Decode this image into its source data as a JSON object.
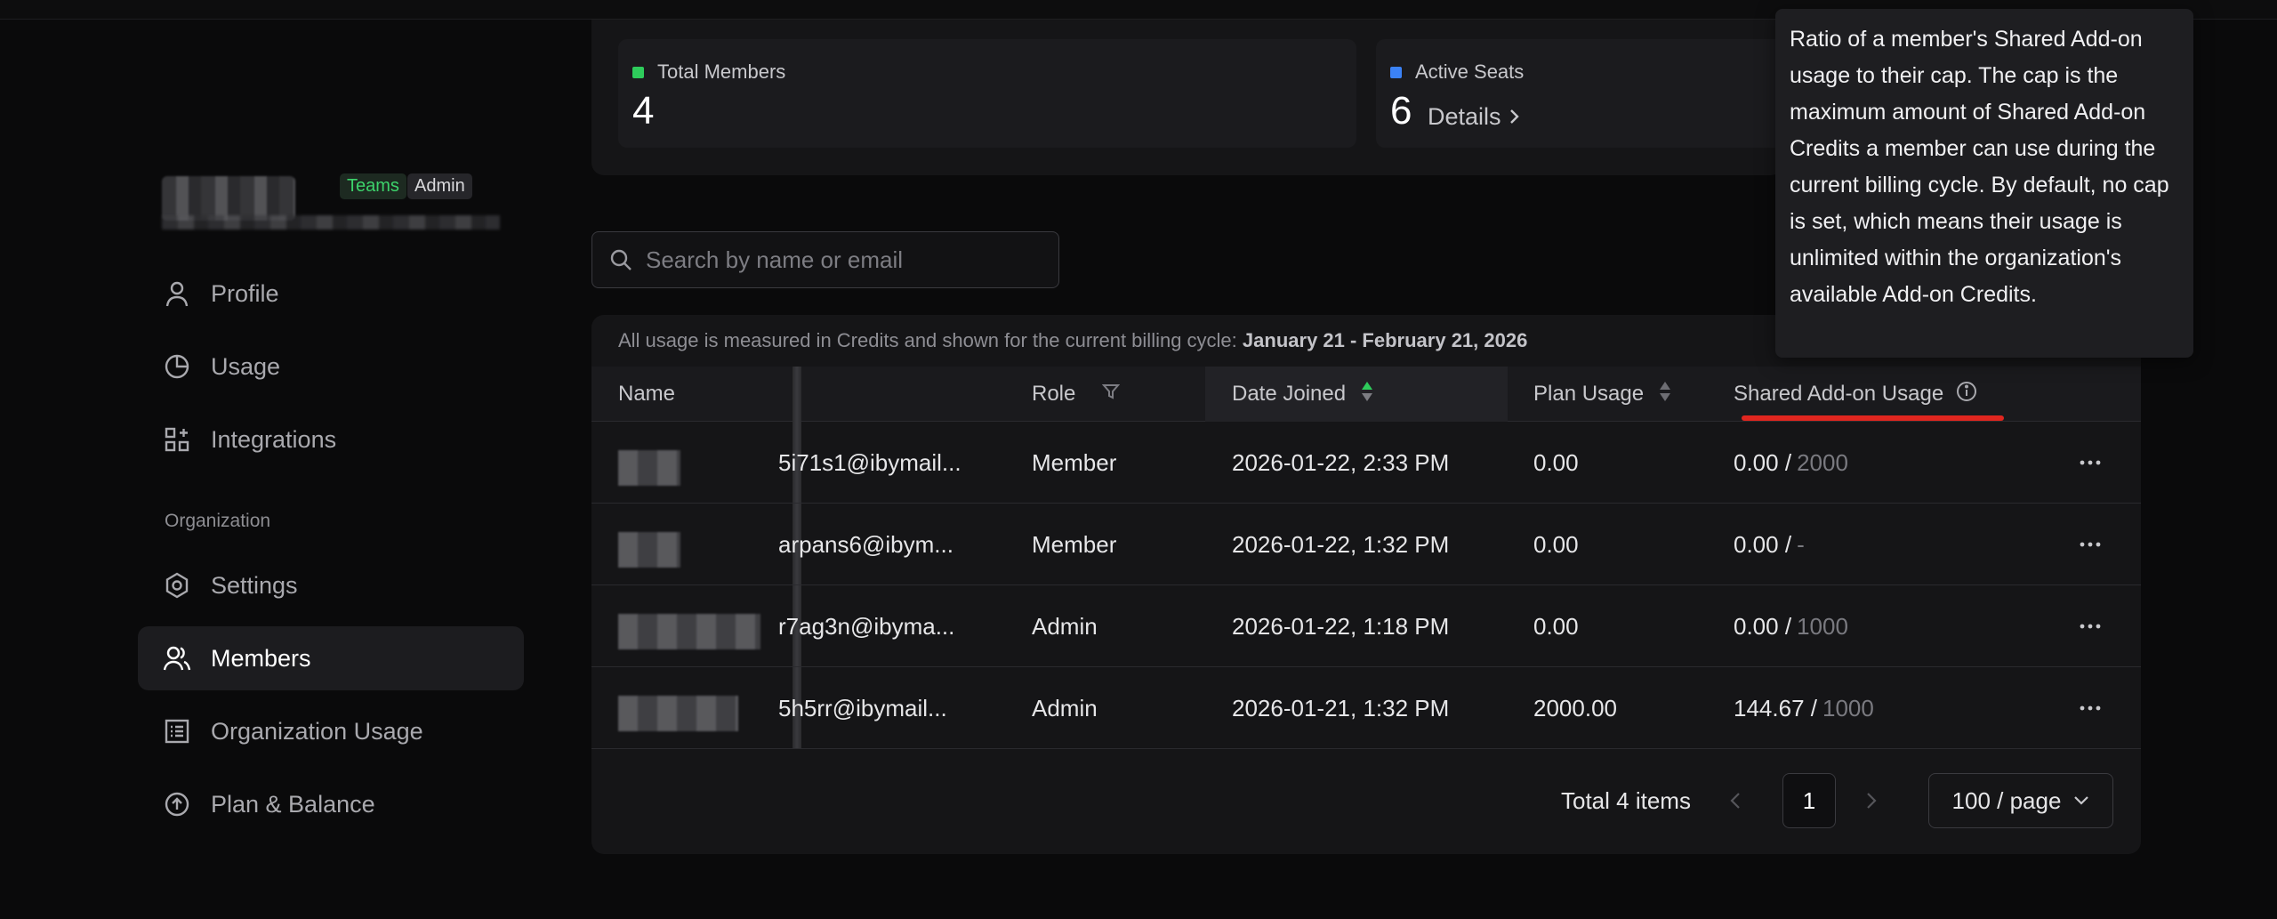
{
  "sidebar": {
    "badges": {
      "teams": "Teams",
      "admin": "Admin"
    },
    "items": [
      {
        "label": "Profile",
        "icon": "user-icon"
      },
      {
        "label": "Usage",
        "icon": "pie-chart-icon"
      },
      {
        "label": "Integrations",
        "icon": "grid-plus-icon"
      }
    ],
    "org_section_label": "Organization",
    "org_items": [
      {
        "label": "Settings",
        "icon": "hexagon-gear-icon"
      },
      {
        "label": "Members",
        "icon": "users-icon",
        "active": true
      },
      {
        "label": "Organization Usage",
        "icon": "list-icon"
      },
      {
        "label": "Plan & Balance",
        "icon": "arrow-up-circle-icon"
      }
    ]
  },
  "stats": {
    "total_members": {
      "label": "Total Members",
      "value": "4",
      "color": "#2ecc5b"
    },
    "active_seats": {
      "label": "Active Seats",
      "value": "6",
      "link": "Details",
      "color": "#3b82f6"
    }
  },
  "search": {
    "placeholder": "Search by name or email"
  },
  "table": {
    "notice_prefix": "All usage is measured in Credits and shown for the current billing cycle:",
    "notice_range": "January 21 - February 21, 2026",
    "columns": {
      "name": "Name",
      "role": "Role",
      "date_joined": "Date Joined",
      "plan_usage": "Plan Usage",
      "shared_usage": "Shared Add-on Usage"
    },
    "rows": [
      {
        "email": "5i71s1@ibymail...",
        "role": "Member",
        "date": "2026-01-22, 2:33 PM",
        "plan": "0.00",
        "shared_used": "0.00 /",
        "shared_cap": "2000"
      },
      {
        "email": "arpans6@ibym...",
        "role": "Member",
        "date": "2026-01-22, 1:32 PM",
        "plan": "0.00",
        "shared_used": "0.00 /",
        "shared_cap": "-"
      },
      {
        "email": "r7ag3n@ibyma...",
        "role": "Admin",
        "date": "2026-01-22, 1:18 PM",
        "plan": "0.00",
        "shared_used": "0.00 /",
        "shared_cap": "1000"
      },
      {
        "email": "5h5rr@ibymail...",
        "role": "Admin",
        "date": "2026-01-21, 1:32 PM",
        "plan": "2000.00",
        "shared_used": "144.67 /",
        "shared_cap": "1000"
      }
    ]
  },
  "pagination": {
    "total": "Total 4 items",
    "page": "1",
    "page_size": "100 / page"
  },
  "tooltip": {
    "text": "Ratio of a member's Shared Add-on usage to their cap. The cap is the maximum amount of Shared Add-on Credits a member can use during the current billing cycle. By default, no cap is set, which means their usage is unlimited within the organization's available Add-on Credits."
  },
  "colors": {
    "accent_red": "#e0261f",
    "sort_green": "#2ecc5b"
  }
}
